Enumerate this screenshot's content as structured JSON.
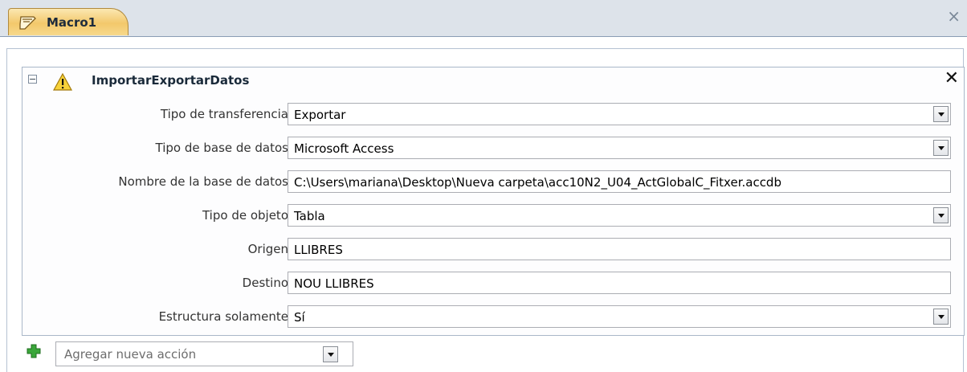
{
  "window": {
    "tab_label": "Macro1",
    "tab_close_glyph": "×"
  },
  "action": {
    "name": "ImportarExportarDatos",
    "collapse_glyph": "−",
    "close_glyph": "✕",
    "warning_icon": "warning-icon",
    "arguments": [
      {
        "label": "Tipo de transferencia",
        "value": "Exportar",
        "dropdown": true
      },
      {
        "label": "Tipo de base de datos",
        "value": "Microsoft Access",
        "dropdown": true
      },
      {
        "label": "Nombre de la base de datos",
        "value": "C:\\Users\\mariana\\Desktop\\Nueva carpeta\\acc10N2_U04_ActGlobalC_Fitxer.accdb",
        "dropdown": false
      },
      {
        "label": "Tipo de objeto",
        "value": "Tabla",
        "dropdown": true
      },
      {
        "label": "Origen",
        "value": "LLIBRES",
        "dropdown": false
      },
      {
        "label": "Destino",
        "value": "NOU LLIBRES",
        "dropdown": false
      },
      {
        "label": "Estructura solamente",
        "value": "Sí",
        "dropdown": true
      }
    ]
  },
  "add_action": {
    "icon": "plus-icon",
    "placeholder": "Agregar nueva acción"
  },
  "colors": {
    "tab_accent": "#f3c86b",
    "plus_green": "#3aa63a",
    "warning_yellow": "#f7d23a"
  }
}
